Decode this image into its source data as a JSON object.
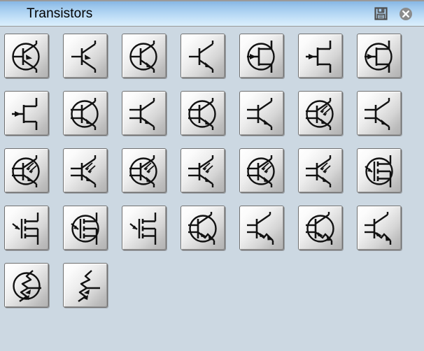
{
  "window": {
    "title": "Transistors",
    "background_color": "#ccd8e2",
    "titlebar_gradient_top": "#8ab9e6",
    "titlebar_gradient_bottom": "#d9eefc"
  },
  "titlebar_buttons": [
    {
      "name": "save-button",
      "icon": "floppy-disk-icon",
      "label": "Save"
    },
    {
      "name": "close-button",
      "icon": "close-icon",
      "label": "Close"
    }
  ],
  "palette": {
    "columns": 7,
    "button_size_px": 64,
    "rows": [
      {
        "items": [
          {
            "id": "pnp-bjt-enclosed",
            "label": "PNP bipolar transistor (enclosed)",
            "shape": "bjt-circle-in"
          },
          {
            "id": "pnp-bjt",
            "label": "PNP bipolar transistor",
            "shape": "bjt-plain-in"
          },
          {
            "id": "npn-bjt-enclosed",
            "label": "NPN bipolar transistor (enclosed)",
            "shape": "bjt-circle-out"
          },
          {
            "id": "npn-bjt",
            "label": "NPN bipolar transistor",
            "shape": "bjt-plain-out"
          },
          {
            "id": "n-jfet-enclosed",
            "label": "N-channel JFET (enclosed)",
            "shape": "jfet-circle-in"
          },
          {
            "id": "n-jfet",
            "label": "N-channel JFET",
            "shape": "jfet-plain-in"
          },
          {
            "id": "p-jfet-enclosed",
            "label": "P-channel JFET (enclosed)",
            "shape": "jfet-circle-out"
          }
        ]
      },
      {
        "items": [
          {
            "id": "p-jfet",
            "label": "P-channel JFET",
            "shape": "jfet-plain-out"
          },
          {
            "id": "pnp-darlington-enclosed",
            "label": "PNP Darlington (enclosed)",
            "shape": "multi-circle-in"
          },
          {
            "id": "pnp-darlington",
            "label": "PNP Darlington",
            "shape": "multi-plain-in"
          },
          {
            "id": "npn-darlington-enclosed",
            "label": "NPN Darlington (enclosed)",
            "shape": "multi-circle-out"
          },
          {
            "id": "npn-darlington",
            "label": "NPN Darlington",
            "shape": "multi-plain-out"
          },
          {
            "id": "pnp-multi-emitter-enclosed",
            "label": "PNP multi-emitter (enclosed)",
            "shape": "multiem-circle-in"
          },
          {
            "id": "pnp-multi-emitter",
            "label": "PNP multi-emitter",
            "shape": "multiem-plain-in"
          }
        ]
      },
      {
        "items": [
          {
            "id": "pnp-phototransistor-enclosed",
            "label": "PNP phototransistor (enclosed)",
            "shape": "photo-circle-in"
          },
          {
            "id": "pnp-phototransistor",
            "label": "PNP phototransistor",
            "shape": "photo-plain-in"
          },
          {
            "id": "npn-phototransistor-enclosed",
            "label": "NPN phototransistor (enclosed)",
            "shape": "photo-circle-out"
          },
          {
            "id": "npn-phototransistor",
            "label": "NPN phototransistor",
            "shape": "photo-plain-out"
          },
          {
            "id": "photo-darlington-enclosed",
            "label": "Photo Darlington (enclosed)",
            "shape": "photo2-circle-in"
          },
          {
            "id": "photo-darlington",
            "label": "Photo Darlington",
            "shape": "photo2-plain-in"
          },
          {
            "id": "p-mosfet-enclosed",
            "label": "P-channel MOSFET (enclosed)",
            "shape": "mosfet-circle-in"
          }
        ]
      },
      {
        "items": [
          {
            "id": "p-mosfet",
            "label": "P-channel MOSFET",
            "shape": "mosfet-plain-in"
          },
          {
            "id": "n-mosfet-enclosed",
            "label": "N-channel MOSFET (enclosed)",
            "shape": "mosfet-circle-out"
          },
          {
            "id": "n-mosfet",
            "label": "N-channel MOSFET",
            "shape": "mosfet-plain-out"
          },
          {
            "id": "ujt-enclosed",
            "label": "Unijunction transistor (enclosed)",
            "shape": "ujt-circle-in"
          },
          {
            "id": "ujt",
            "label": "Unijunction transistor",
            "shape": "ujt-plain-in"
          },
          {
            "id": "ujt-p-enclosed",
            "label": "P-type unijunction transistor (enclosed)",
            "shape": "ujt-circle-out"
          },
          {
            "id": "ujt-p",
            "label": "P-type unijunction transistor",
            "shape": "ujt-plain-out"
          }
        ]
      },
      {
        "items": [
          {
            "id": "put-enclosed",
            "label": "Programmable UJT (enclosed)",
            "shape": "put-circle"
          },
          {
            "id": "put",
            "label": "Programmable UJT",
            "shape": "put-plain"
          }
        ]
      }
    ]
  }
}
